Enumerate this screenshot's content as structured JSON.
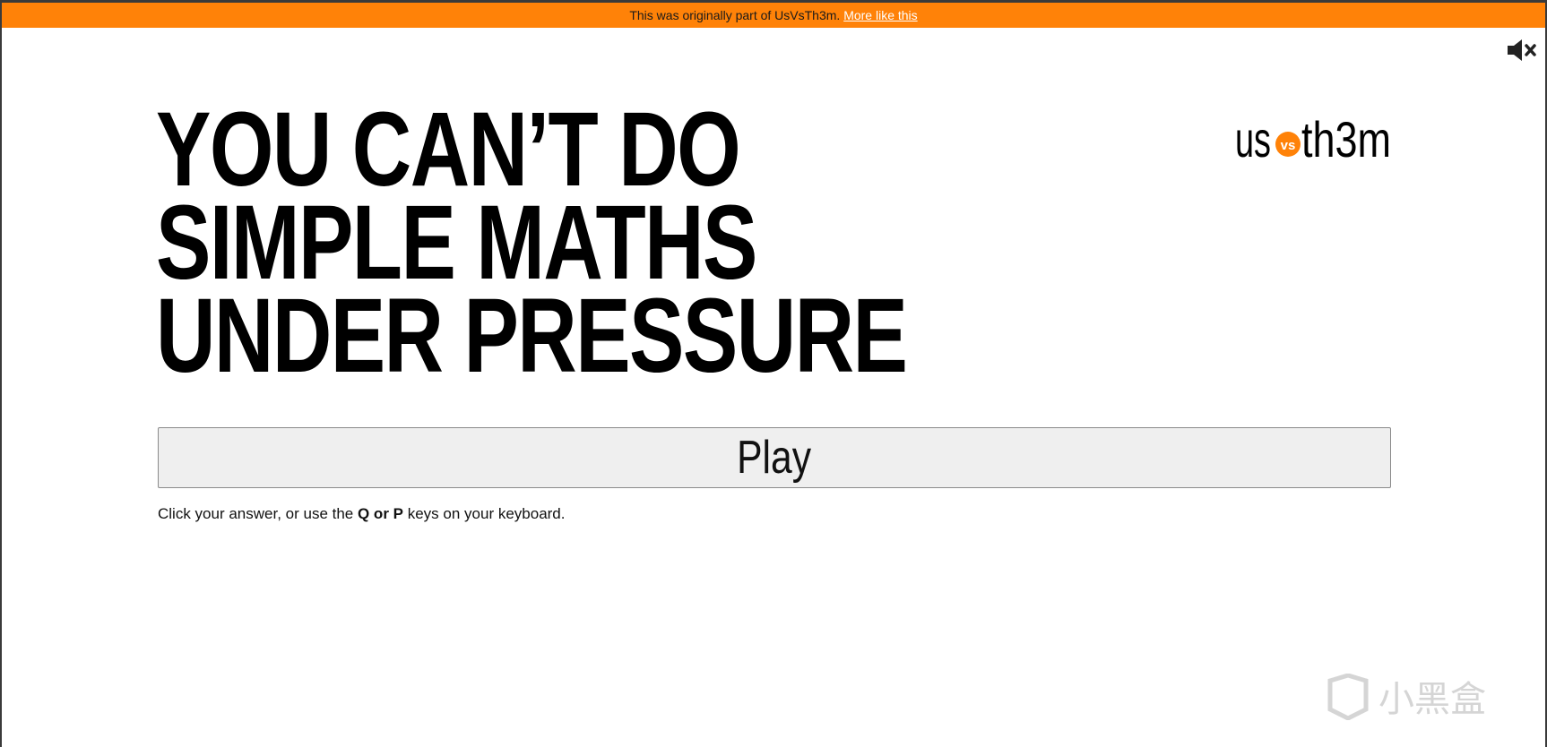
{
  "banner": {
    "text": "This was originally part of UsVsTh3m.",
    "link_label": "More like this"
  },
  "mute": {
    "icon": "mute-icon"
  },
  "title": {
    "line1": "YOU CAN’T DO",
    "line2": "SIMPLE MATHS",
    "line3": "UNDER PRESSURE"
  },
  "logo": {
    "left_text": "us",
    "badge_text": "vs",
    "right_text": "th3m",
    "badge_color": "#ff8208"
  },
  "play": {
    "label": "Play"
  },
  "instructions": {
    "prefix": "Click your answer, or use the ",
    "keys": "Q or P",
    "suffix": " keys on your keyboard."
  },
  "watermark": {
    "text": "小黑盒"
  },
  "colors": {
    "accent": "#ff8208",
    "text": "#000000",
    "button_bg": "#efefef"
  }
}
